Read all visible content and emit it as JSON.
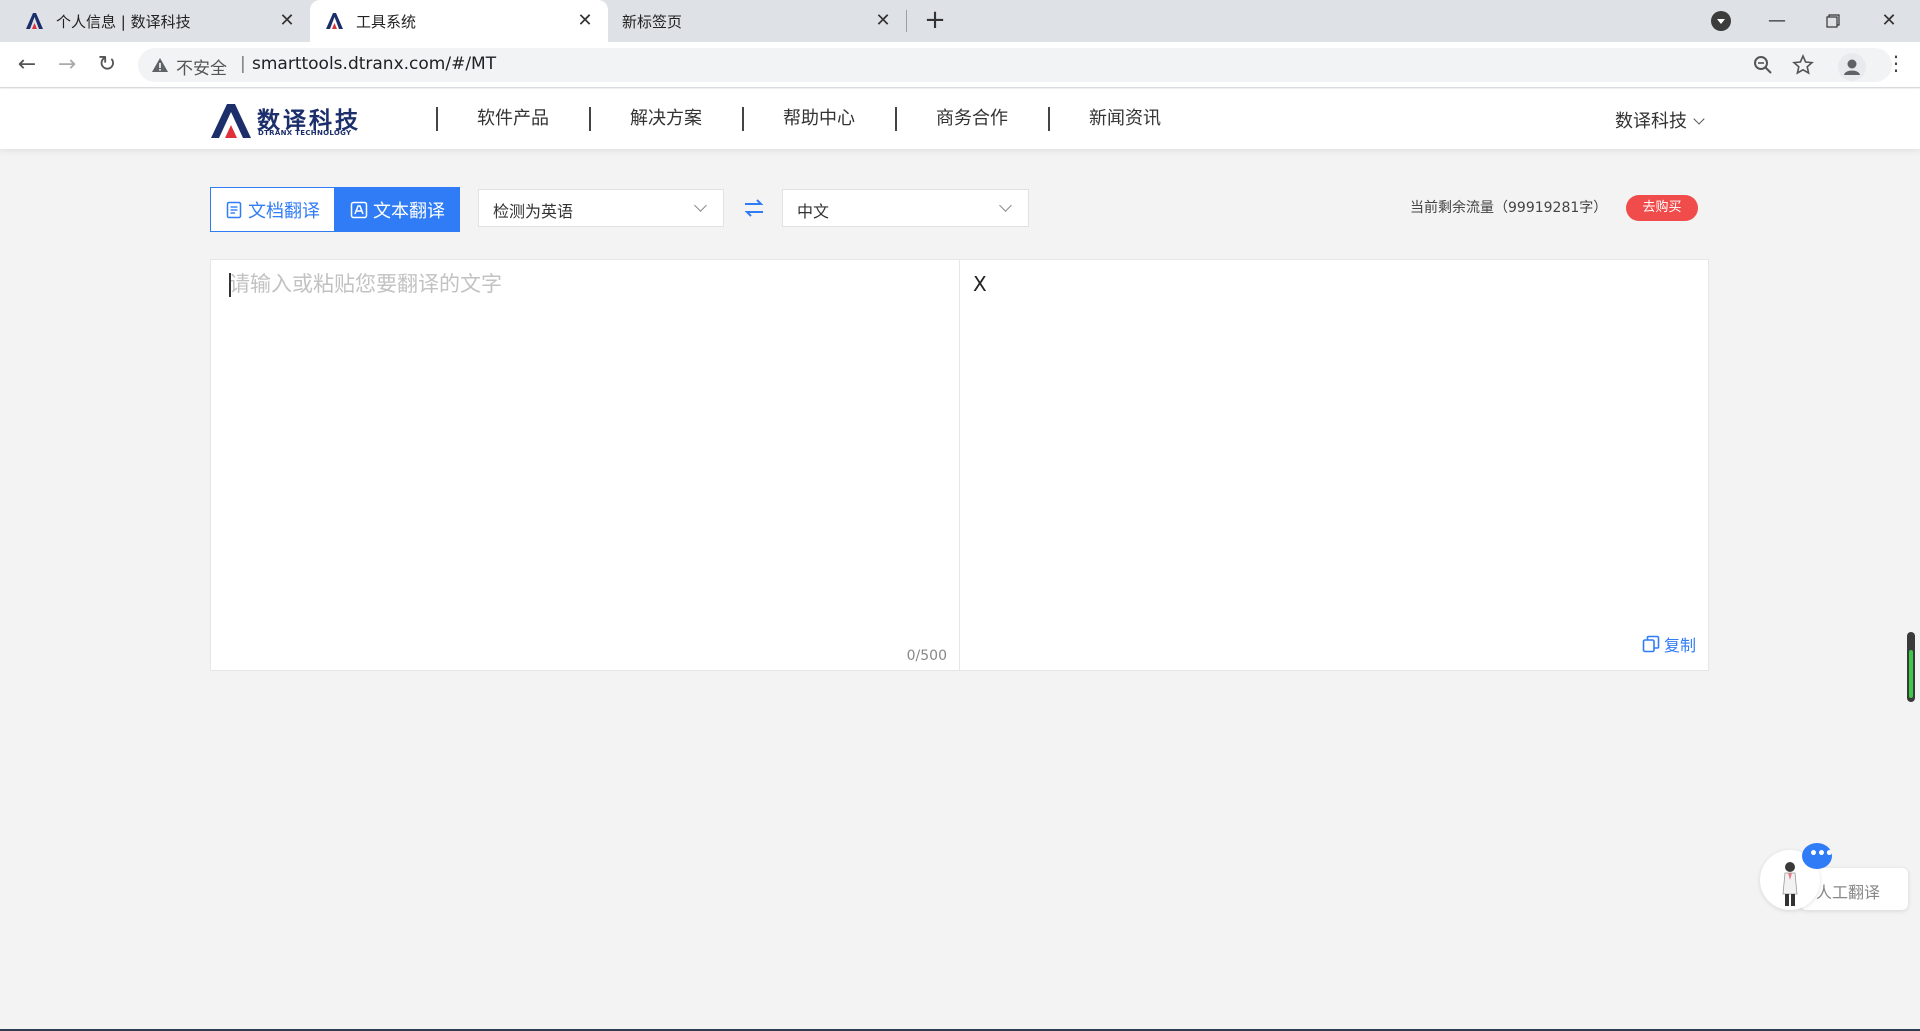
{
  "browser": {
    "tabs": [
      {
        "title": "个人信息 | 数译科技",
        "active": false
      },
      {
        "title": "工具系统",
        "active": true
      },
      {
        "title": "新标签页",
        "active": false
      }
    ],
    "new_tab_label": "+",
    "close_label": "✕",
    "security_label": "不安全",
    "separator": "|",
    "url": "smarttools.dtranx.com/#/MT"
  },
  "header": {
    "brand_cn": "数译科技",
    "brand_en": "DTRANX TECHNOLOGY",
    "nav": [
      "软件产品",
      "解决方案",
      "帮助中心",
      "商务合作",
      "新闻资讯"
    ],
    "user_menu_label": "数译科技"
  },
  "toolbar": {
    "doc_mode_label": "文档翻译",
    "text_mode_label": "文本翻译",
    "active_mode": "文本翻译",
    "source_lang": "检测为英语",
    "target_lang": "中文",
    "quota_text": "当前剩余流量（99919281字）",
    "buy_label": "去购买"
  },
  "editor": {
    "placeholder": "请输入或粘贴您要翻译的文字",
    "source_text": "",
    "char_count": "0/500",
    "target_text": "X",
    "copy_label": "复制"
  },
  "floating": {
    "human_translate_label": "人工翻译",
    "chat_dots": "•••"
  },
  "colors": {
    "accent": "#2f7cf6",
    "buy_red": "#f14c4c",
    "brand_navy": "#1c2f6b",
    "page_bg": "#f3f3f3"
  }
}
